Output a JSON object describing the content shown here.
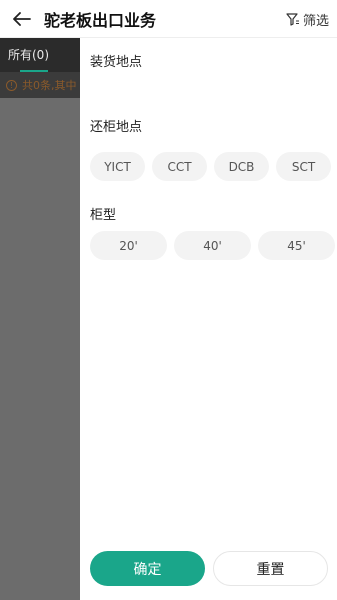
{
  "header": {
    "title": "驼老板出口业务",
    "filter_label": "筛选"
  },
  "background_page": {
    "tab_all_label": "所有(0)",
    "notice_text": "共0条,其中"
  },
  "filter_panel": {
    "loading_location_label": "装货地点",
    "return_location_label": "还柜地点",
    "return_locations": [
      "YICT",
      "CCT",
      "DCB",
      "SCT"
    ],
    "container_type_label": "柜型",
    "container_types": [
      "20'",
      "40'",
      "45'"
    ],
    "confirm_label": "确定",
    "reset_label": "重置"
  },
  "colors": {
    "accent": "#1aa68a",
    "notice": "#8a5a2b",
    "chip_bg": "#f3f3f3"
  }
}
